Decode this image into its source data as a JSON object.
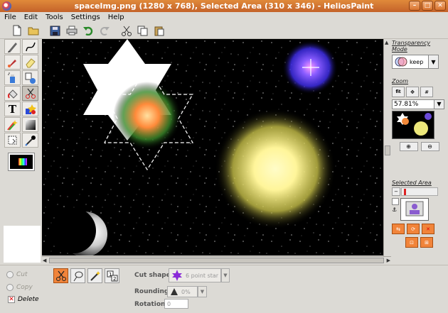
{
  "window": {
    "title": "spaceImg.png (1280 x 768), Selected Area (310 x 346) - HeliosPaint"
  },
  "menu": {
    "file": "File",
    "edit": "Edit",
    "tools": "Tools",
    "settings": "Settings",
    "help": "Help"
  },
  "transparency": {
    "label": "Transparency Mode",
    "value": "keep"
  },
  "zoom": {
    "label": "Zoom",
    "value": "57.81%"
  },
  "selected_area": {
    "label": "Selected Area"
  },
  "bottom": {
    "cut_label": "Cut",
    "copy_label": "Copy",
    "delete_label": "Delete",
    "cut_shape_label": "Cut shape:",
    "cut_shape_value": "6 point star",
    "rounding_label": "Rounding:",
    "rounding_value": "0%",
    "rotation_label": "Rotation:",
    "rotation_value": "0"
  },
  "colors": {
    "accent": "#f1843a",
    "titlebar": "#d0702f",
    "canvas_bg": "#000000"
  }
}
